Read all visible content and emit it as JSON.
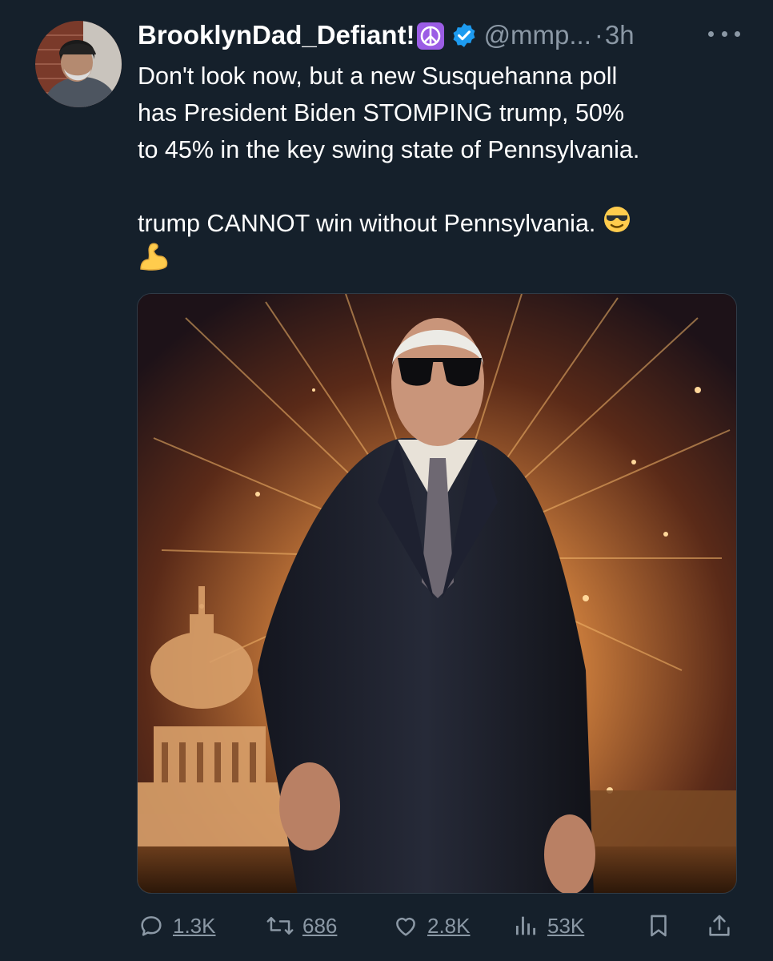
{
  "author": {
    "display_name": "BrooklynDad_Defiant!",
    "handle": "@mmp...",
    "separator": "·",
    "time": "3h",
    "badges": [
      "peace-symbol-icon",
      "verified-badge-icon"
    ]
  },
  "tweet": {
    "lines": [
      "Don't look now, but a new Susquehanna poll",
      "has President Biden STOMPING trump, 50%",
      "to 45% in the key swing state of Pennsylvania."
    ],
    "line4": "trump CANNOT win without Pennsylvania.",
    "emojis": [
      "smiling-face-with-sunglasses-emoji",
      "flexed-biceps-emoji"
    ]
  },
  "media": {
    "description_icon": "photo",
    "accent_colors": [
      "#f5c26b",
      "#3a1a0c",
      "#1a1f2e"
    ]
  },
  "actions": {
    "replies": "1.3K",
    "reposts": "686",
    "likes": "2.8K",
    "views": "53K"
  },
  "colors": {
    "background": "#15202b",
    "muted": "#8b98a5",
    "verified": "#1d9bf0"
  }
}
